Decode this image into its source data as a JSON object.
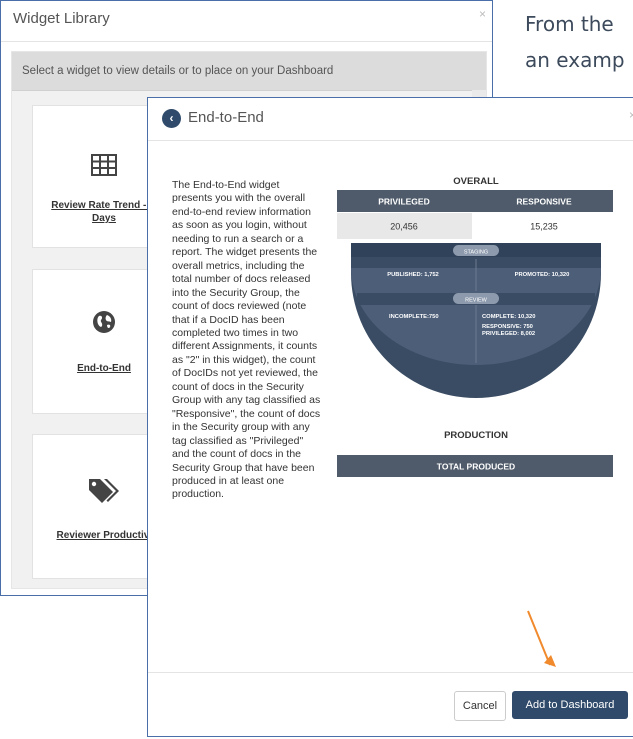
{
  "background": {
    "line1": "From the",
    "line2": "an examp"
  },
  "library": {
    "title": "Widget Library",
    "close": "×",
    "instruction": "Select a widget to view details or to place on your Dashboard",
    "tiles": [
      {
        "label_line1": "Review Rate Trend - La",
        "label_line2": "Days",
        "icon": "table-icon"
      },
      {
        "label_line1": "End-to-End",
        "icon": "globe-icon"
      },
      {
        "label_line1": "Reviewer Productivit",
        "icon": "tags-icon"
      }
    ]
  },
  "dialog": {
    "title": "End-to-End",
    "back_glyph": "‹",
    "close": "×",
    "description": "The End-to-End widget presents you with the overall end-to-end review information as soon as you login, without needing to run a search or a report. The widget presents the overall metrics, including the total number of docs released into the Security Group, the count of docs reviewed (note that if a DocID has been completed two times in two different Assignments, it counts as \"2\" in this widget), the count of DocIDs not yet reviewed, the count of docs in the Security Group with any tag classified as \"Responsive\", the count of docs in the Security group with any tag classified as \"Privileged\" and the count of docs in the Security Group that have been produced in at least one production.",
    "preview": {
      "overall": "OVERALL",
      "privileged_label": "PRIVILEGED",
      "responsive_label": "RESPONSIVE",
      "privileged_value": "20,456",
      "responsive_value": "15,235",
      "staging": "STAGING",
      "published": "PUBLISHED:  1,752",
      "promoted": "PROMOTED:  10,320",
      "review": "REVIEW",
      "incomplete": "INCOMPLETE:750",
      "complete": "COMPLETE: 10,320",
      "responsive_sub": "RESPONSIVE:  750",
      "privileged_sub": "PRIVILEGED:  8,002",
      "production": "PRODUCTION",
      "total_produced": "TOTAL PRODUCED"
    },
    "cancel_label": "Cancel",
    "add_label": "Add to Dashboard"
  },
  "colors": {
    "accent": "#2f4a6a",
    "window_border": "#4a6fa8",
    "annotation_arrow": "#f08a2c"
  }
}
